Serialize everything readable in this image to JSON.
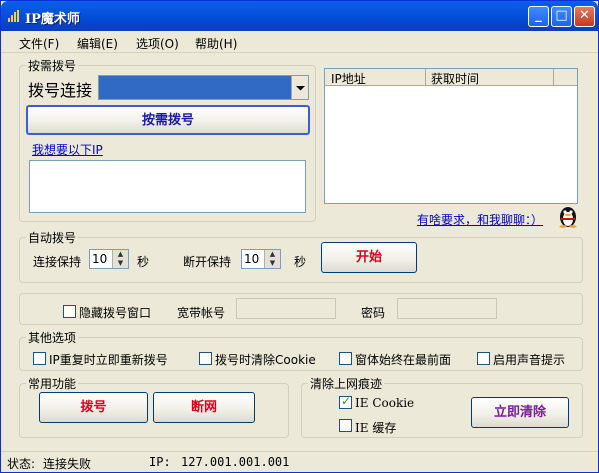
{
  "window": {
    "title": "IP魔术师",
    "min": "_",
    "max": "□",
    "close": "✕"
  },
  "menu": [
    "文件(F)",
    "编辑(E)",
    "选项(O)",
    "帮助(H)"
  ],
  "dial": {
    "group_title": "按需拨号",
    "connection_label": "拨号连接",
    "connection_value": "",
    "dial_button": "按需拨号",
    "want_ip_link": "我想要以下IP",
    "ip_list_value": ""
  },
  "ip_table": {
    "columns": [
      "IP地址",
      "获取时间"
    ],
    "rows": []
  },
  "chat_link": "有啥要求，和我聊聊：）",
  "auto_dial": {
    "group_title": "自动拨号",
    "connect_keep_label": "连接保持",
    "connect_keep_value": "10",
    "connect_unit": "秒",
    "disconnect_keep_label": "断开保持",
    "disconnect_keep_value": "10",
    "disconnect_unit": "秒",
    "start_button": "开始"
  },
  "account": {
    "hide_window_label": "隐藏拨号窗口",
    "broadband_label": "宽带帐号",
    "password_label": "密码"
  },
  "other": {
    "group_title": "其他选项",
    "options": [
      "IP重复时立即重新拨号",
      "拨号时清除Cookie",
      "窗体始终在最前面",
      "启用声音提示"
    ]
  },
  "common": {
    "group_title": "常用功能",
    "dial_button": "拨号",
    "disconnect_button": "断网"
  },
  "clear": {
    "group_title": "清除上网痕迹",
    "ie_cookie_label": "IE Cookie",
    "ie_cache_label": "IE 缓存",
    "clear_button": "立即清除"
  },
  "status": {
    "label": "状态:",
    "value": "连接失败",
    "ip_label": "IP:",
    "ip_value": "127.001.001.001"
  },
  "colors": {
    "red_button_text": "#e0001a",
    "blue_button_text": "#1a1aa8",
    "purple_button_text": "#7a1f9a",
    "combo_fill": "#316ac5"
  }
}
